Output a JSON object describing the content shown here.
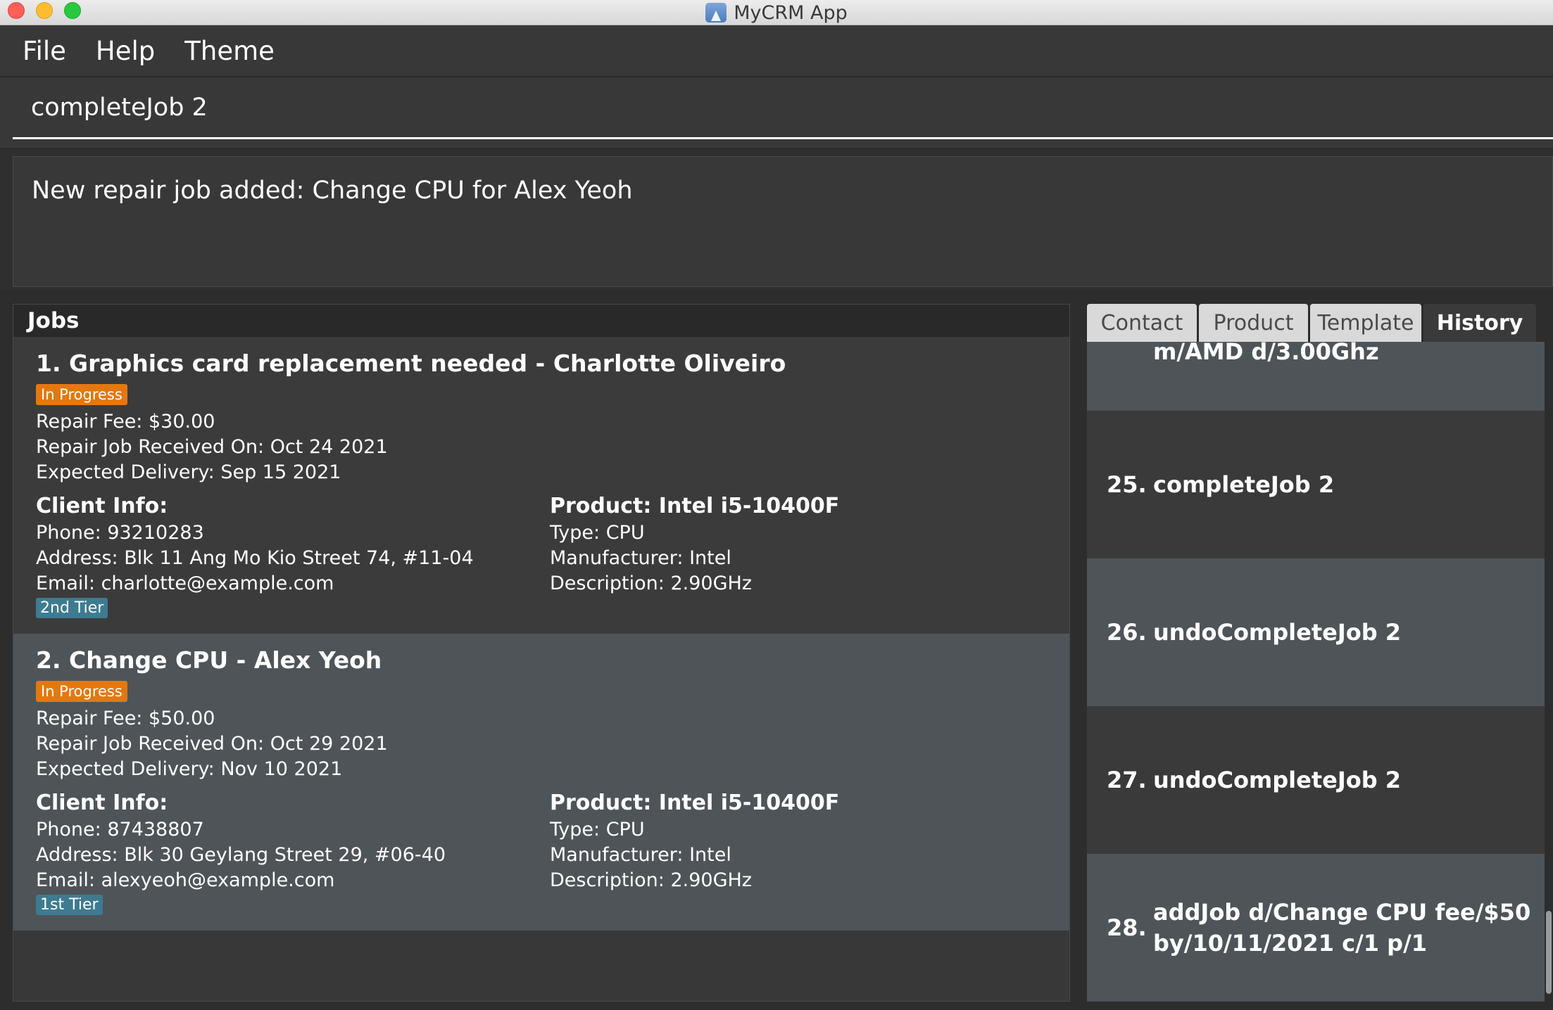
{
  "window": {
    "title": "MyCRM App"
  },
  "menu": [
    "File",
    "Help",
    "Theme"
  ],
  "command": {
    "value": "completeJob 2"
  },
  "result": {
    "message": "New repair job added: Change CPU for Alex Yeoh"
  },
  "jobs": {
    "header": "Jobs",
    "items": [
      {
        "title": "1. Graphics card replacement needed - Charlotte Oliveiro",
        "status": "In Progress",
        "fee": "Repair Fee: $30.00",
        "received": "Repair Job Received On: Oct 24 2021",
        "delivery": "Expected Delivery: Sep 15 2021",
        "client_heading": "Client Info:",
        "phone": "Phone: 93210283",
        "address": "Address: Blk 11 Ang Mo Kio Street 74, #11-04",
        "email": "Email: charlotte@example.com",
        "tier": "2nd Tier",
        "product_heading": "Product: Intel i5-10400F",
        "type": "Type: CPU",
        "manufacturer": "Manufacturer: Intel",
        "description": "Description: 2.90GHz"
      },
      {
        "title": "2. Change CPU - Alex Yeoh",
        "status": "In Progress",
        "fee": "Repair Fee: $50.00",
        "received": "Repair Job Received On: Oct 29 2021",
        "delivery": "Expected Delivery: Nov 10 2021",
        "client_heading": "Client Info:",
        "phone": "Phone: 87438807",
        "address": "Address: Blk 30 Geylang Street 29, #06-40",
        "email": "Email: alexyeoh@example.com",
        "tier": "1st Tier",
        "product_heading": "Product: Intel i5-10400F",
        "type": "Type: CPU",
        "manufacturer": "Manufacturer: Intel",
        "description": "Description: 2.90GHz"
      }
    ]
  },
  "tabs": [
    "Contact",
    "Product",
    "Template",
    "History"
  ],
  "active_tab": "History",
  "history": [
    {
      "num": "",
      "text": "m/AMD d/3.00Ghz"
    },
    {
      "num": "25.",
      "text": "completeJob 2"
    },
    {
      "num": "26.",
      "text": "undoCompleteJob 2"
    },
    {
      "num": "27.",
      "text": "undoCompleteJob 2"
    },
    {
      "num": "28.",
      "text_line1": "addJob d/Change CPU fee/$50",
      "text_line2": "by/10/11/2021 c/1 p/1"
    }
  ],
  "colors": {
    "status_badge": "#e4780f",
    "tier_badge": "#3e7b91",
    "background": "#2d2d2d"
  }
}
